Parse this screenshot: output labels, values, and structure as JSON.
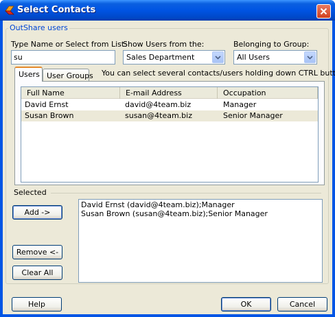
{
  "window": {
    "title": "Select Contacts",
    "icon": "outshare-app-icon",
    "close_icon": "close-icon"
  },
  "group": {
    "legend": "OutShare users"
  },
  "filters": {
    "name_label": "Type Name or Select from List:",
    "name_value": "su",
    "show_users_label": "Show Users from the:",
    "show_users_value": "Sales Department",
    "belonging_label": "Belonging to Group:",
    "belonging_value": "All Users"
  },
  "tabs": [
    {
      "label": "Users",
      "active": true
    },
    {
      "label": "User Groups",
      "active": false
    }
  ],
  "hint": "You can select several contacts/users holding down CTRL button",
  "contacts_table": {
    "columns": [
      "Full Name",
      "E-mail Address",
      "Occupation"
    ],
    "rows": [
      {
        "name": "David Ernst",
        "email": "david@4team.biz",
        "occupation": "Manager",
        "selected": false
      },
      {
        "name": "Susan Brown",
        "email": "susan@4team.biz",
        "occupation": "Senior Manager",
        "selected": true
      }
    ]
  },
  "selected_section": {
    "label": "Selected",
    "add_button": "Add ->",
    "remove_button": "Remove <-",
    "clear_button": "Clear All",
    "entries": [
      "David Ernst (david@4team.biz);Manager",
      "Susan Brown (susan@4team.biz);Senior Manager"
    ]
  },
  "footer": {
    "help_button": "Help",
    "ok_button": "OK",
    "cancel_button": "Cancel"
  },
  "colors": {
    "title_bar": "#0054e3",
    "window_face": "#ece9d8",
    "group_legend": "#0046d5",
    "active_tab_accent": "#e68b2c"
  }
}
